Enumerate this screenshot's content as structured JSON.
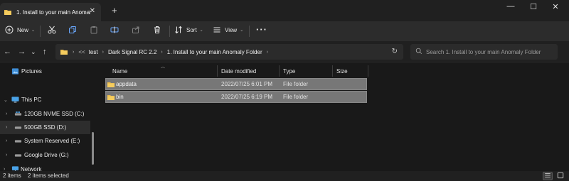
{
  "tab": {
    "title": "1. Install to your main Anomaly Folder"
  },
  "commands": {
    "new_label": "New",
    "sort_label": "Sort",
    "view_label": "View",
    "more_label": "···"
  },
  "breadcrumb": {
    "overflow": "<<",
    "items": [
      "test",
      "Dark Signal RC 2.2",
      "1. Install to your main Anomaly Folder"
    ]
  },
  "search": {
    "placeholder": "Search 1. Install to your main Anomaly Folder"
  },
  "sidebar": {
    "items": [
      {
        "label": "Pictures",
        "icon": "pictures-icon"
      },
      {
        "label": "This PC",
        "icon": "pc-icon"
      },
      {
        "label": "120GB NVME SSD (C:)",
        "icon": "drive-icon"
      },
      {
        "label": "500GB SSD (D:)",
        "icon": "drive-icon"
      },
      {
        "label": "System Reserved (E:)",
        "icon": "drive-icon"
      },
      {
        "label": "Google Drive (G:)",
        "icon": "drive-icon"
      },
      {
        "label": "Network",
        "icon": "network-icon"
      }
    ]
  },
  "columns": [
    "Name",
    "Date modified",
    "Type",
    "Size"
  ],
  "files": [
    {
      "name": "appdata",
      "date": "2022/07/25 6:01 PM",
      "type": "File folder",
      "size": ""
    },
    {
      "name": "bin",
      "date": "2022/07/25 6:19 PM",
      "type": "File folder",
      "size": ""
    }
  ],
  "status": {
    "count": "2 items",
    "selected": "2 items selected"
  },
  "colors": {
    "folder": "#e8b84a",
    "selection": "#777777",
    "background": "#191919",
    "drive": "#9a9a9a"
  }
}
